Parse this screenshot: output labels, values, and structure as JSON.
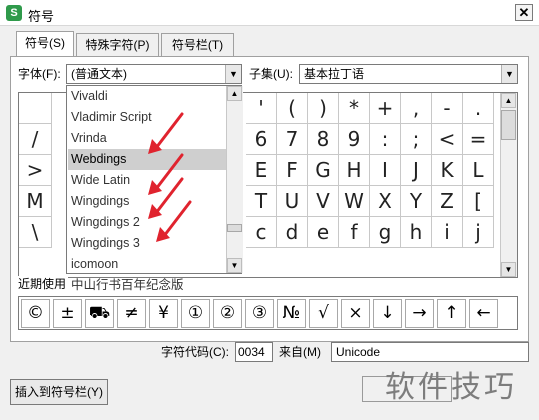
{
  "window": {
    "title": "符号",
    "app_icon": "S",
    "close_glyph": "✕"
  },
  "tabs": [
    {
      "label": "符号(S)",
      "active": true
    },
    {
      "label": "特殊字符(P)",
      "active": false
    },
    {
      "label": "符号栏(T)",
      "active": false
    }
  ],
  "font": {
    "label": "字体(F):",
    "value": "(普通文本)"
  },
  "subset": {
    "label": "子集(U):",
    "value": "基本拉丁语"
  },
  "dropdown_items": [
    "Vivaldi",
    "Vladimir Script",
    "Vrinda",
    "Webdings",
    "Wide Latin",
    "Wingdings",
    "Wingdings 2",
    "Wingdings 3",
    "icomoon",
    "中山行书百年纪念版"
  ],
  "dropdown_selected": "Webdings",
  "left_column": [
    "",
    "/",
    ">",
    "M",
    "\\"
  ],
  "symbol_rows": [
    [
      "'",
      "(",
      ")",
      "*",
      "+",
      ",",
      "-",
      "."
    ],
    [
      "6",
      "7",
      "8",
      "9",
      ":",
      ";",
      "<",
      "="
    ],
    [
      "E",
      "F",
      "G",
      "H",
      "I",
      "J",
      "K",
      "L"
    ],
    [
      "T",
      "U",
      "V",
      "W",
      "X",
      "Y",
      "Z",
      "["
    ],
    [
      "c",
      "d",
      "e",
      "f",
      "g",
      "h",
      "i",
      "j"
    ]
  ],
  "recent": {
    "label": "近期使用",
    "symbols": [
      "©",
      "±",
      "⛟",
      "≠",
      "¥",
      "①",
      "②",
      "③",
      "№",
      "√",
      "×",
      "↓",
      "→",
      "↑",
      "←"
    ]
  },
  "char_code": {
    "label": "字符代码(C):",
    "value": "0034",
    "from_label": "来自(M)",
    "from_value": "Unicode"
  },
  "buttons": {
    "insert_to_bar": "插入到符号栏(Y)"
  },
  "watermark": "软件技巧",
  "colors": {
    "arrow": "#e0232e",
    "selected_item": "#cfcfcf"
  }
}
